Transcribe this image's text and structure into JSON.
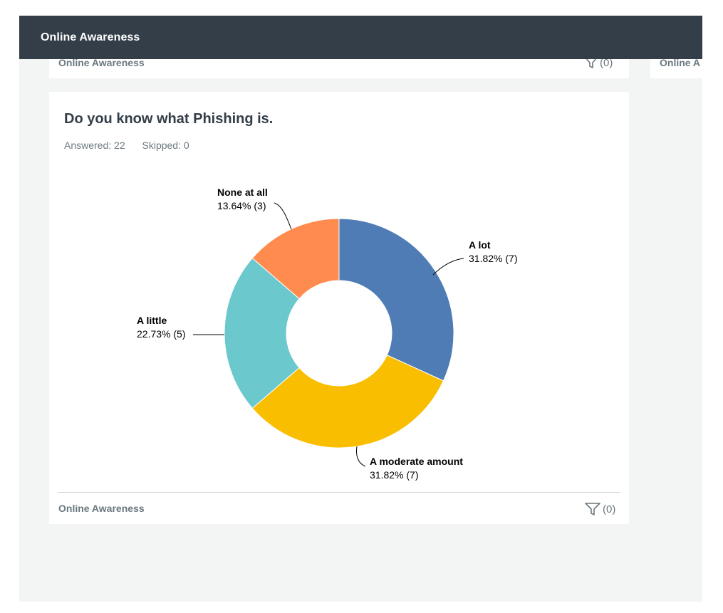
{
  "header": {
    "title": "Online Awareness"
  },
  "top_card": {
    "footer_label": "Online Awareness",
    "filter_count": "(0)"
  },
  "side_card": {
    "footer_label": "Online A"
  },
  "question": {
    "title": "Do you know what Phishing is.",
    "answered": "Answered: 22",
    "skipped": "Skipped: 0"
  },
  "card_footer": {
    "label": "Online Awareness",
    "filter_count": "(0)"
  },
  "colors": {
    "header_bg": "#333e48",
    "a_lot": "#507cb6",
    "a_moderate_amount": "#f9be00",
    "a_little": "#6bc8cd",
    "none_at_all": "#ff8b4f"
  },
  "chart_data": {
    "type": "pie",
    "donut": true,
    "categories": [
      "A lot",
      "A moderate amount",
      "A little",
      "None at all"
    ],
    "values": [
      7,
      7,
      5,
      3
    ],
    "percent_labels": [
      "31.82% (7)",
      "31.82% (7)",
      "22.73% (5)",
      "13.64% (3)"
    ],
    "colors": [
      "#507cb6",
      "#f9be00",
      "#6bc8cd",
      "#ff8b4f"
    ],
    "title": "Do you know what Phishing is."
  }
}
